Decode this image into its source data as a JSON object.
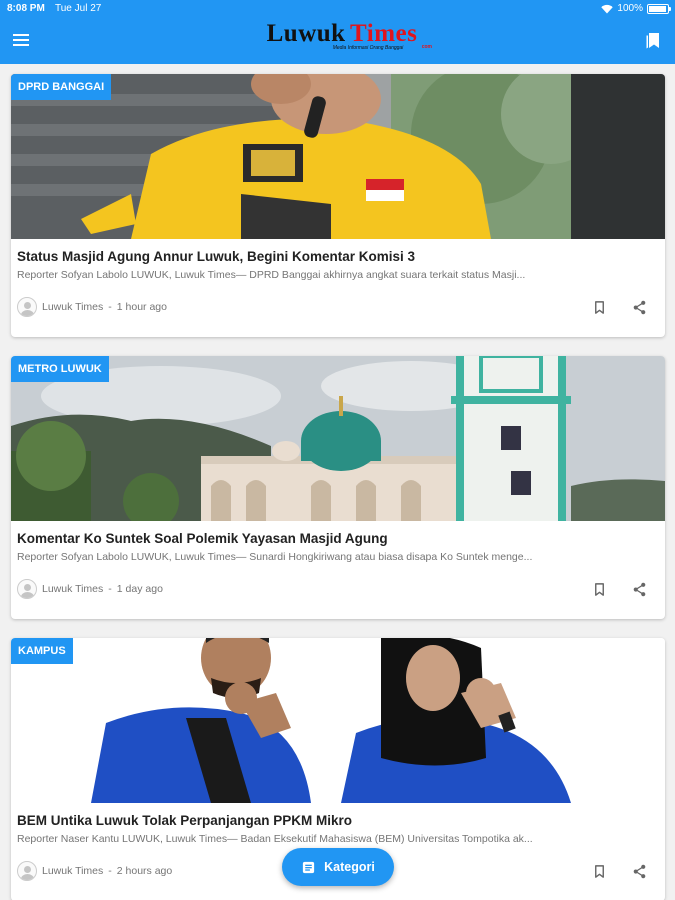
{
  "status_bar": {
    "time": "8:08 PM",
    "date": "Tue Jul 27",
    "battery": "100%"
  },
  "header": {
    "logo_word1": "Luwuk",
    "logo_word2": "Times",
    "logo_tagline": "Media Informasi Orang Banggai",
    "logo_domain": "com",
    "accent_color": "#2196f3",
    "logo_red": "#e0141d"
  },
  "articles": [
    {
      "category": "DPRD BANGGAI",
      "title": "Status Masjid Agung Annur Luwuk, Begini Komentar Komisi 3",
      "excerpt": "Reporter Sofyan Labolo LUWUK, Luwuk Times— DPRD Banggai akhirnya angkat suara terkait status Masji...",
      "author": "Luwuk Times",
      "time": "1 hour ago"
    },
    {
      "category": "METRO LUWUK",
      "title": "Komentar Ko Suntek Soal Polemik Yayasan Masjid Agung",
      "excerpt": "Reporter Sofyan Labolo LUWUK, Luwuk Times— Sunardi Hongkiriwang atau biasa disapa Ko Suntek menge...",
      "author": "Luwuk Times",
      "time": "1 day ago"
    },
    {
      "category": "KAMPUS",
      "title": "BEM Untika Luwuk Tolak Perpanjangan PPKM Mikro",
      "excerpt": "Reporter Naser Kantu LUWUK, Luwuk Times— Badan Eksekutif Mahasiswa (BEM) Universitas Tompotika ak...",
      "author": "Luwuk Times",
      "time": "2 hours ago"
    }
  ],
  "fab": {
    "label": "Kategori"
  }
}
